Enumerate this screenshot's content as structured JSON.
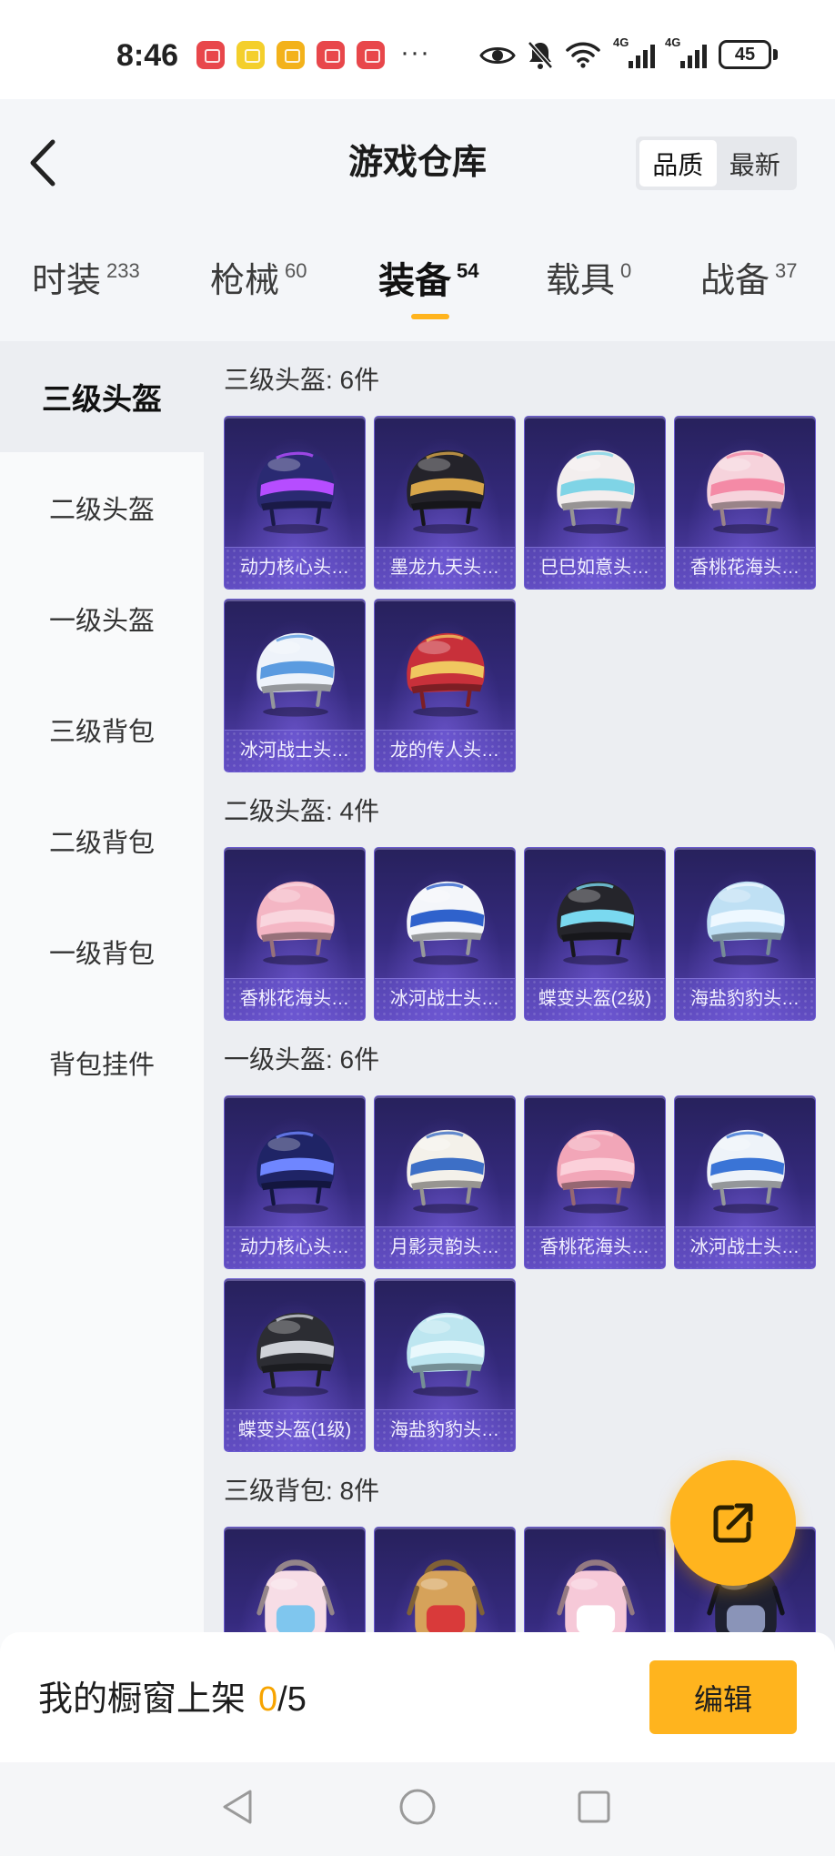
{
  "theme": {
    "accent": "#ffb41e",
    "count_highlight": "#f7a400"
  },
  "status_bar": {
    "time": "8:46",
    "notification_icons": [
      {
        "icon": "huawei-app-icon",
        "color": "#e8474b"
      },
      {
        "icon": "app-icon",
        "color": "#f4cf2c"
      },
      {
        "icon": "app-icon",
        "color": "#f3b21b"
      },
      {
        "icon": "huawei-app-icon",
        "color": "#e8474b"
      },
      {
        "icon": "huawei-app-icon",
        "color": "#e8474b"
      }
    ],
    "more": "···",
    "system_icons": [
      "eye-icon",
      "mute-bell-icon",
      "wifi-icon",
      "cellular-signal-icon",
      "cellular-signal-icon",
      "battery-icon"
    ],
    "network_label": "4G",
    "battery": "45"
  },
  "header": {
    "title": "游戏仓库",
    "back_icon": "chevron-left-icon",
    "sort_options": [
      {
        "label": "品质",
        "selected": true
      },
      {
        "label": "最新",
        "selected": false
      }
    ]
  },
  "tabs": [
    {
      "label": "时装",
      "count": "233",
      "active": false
    },
    {
      "label": "枪械",
      "count": "60",
      "active": false
    },
    {
      "label": "装备",
      "count": "54",
      "active": true
    },
    {
      "label": "载具",
      "count": "0",
      "active": false
    },
    {
      "label": "战备",
      "count": "37",
      "active": false
    }
  ],
  "sidebar": {
    "items": [
      {
        "label": "三级头盔",
        "active": true
      },
      {
        "label": "二级头盔",
        "active": false
      },
      {
        "label": "一级头盔",
        "active": false
      },
      {
        "label": "三级背包",
        "active": false
      },
      {
        "label": "二级背包",
        "active": false
      },
      {
        "label": "一级背包",
        "active": false
      },
      {
        "label": "背包挂件",
        "active": false
      }
    ]
  },
  "sections": [
    {
      "title": "三级头盔: 6件",
      "items": [
        {
          "name": "动力核心头…",
          "icon": "helmet-icon",
          "color": "#2a2a72",
          "accent": "#b64dff"
        },
        {
          "name": "墨龙九天头…",
          "icon": "helmet-icon",
          "color": "#24232a",
          "accent": "#d8a64a"
        },
        {
          "name": "巳巳如意头…",
          "icon": "helmet-icon",
          "color": "#f3eeee",
          "accent": "#7fd4e6"
        },
        {
          "name": "香桃花海头…",
          "icon": "helmet-icon",
          "color": "#f6d3dc",
          "accent": "#f48aa6"
        },
        {
          "name": "冰河战士头…",
          "icon": "helmet-icon",
          "color": "#eef3fa",
          "accent": "#5b9be0"
        },
        {
          "name": "龙的传人头…",
          "icon": "helmet-icon",
          "color": "#c8303a",
          "accent": "#f0c760"
        }
      ]
    },
    {
      "title": "二级头盔: 4件",
      "items": [
        {
          "name": "香桃花海头…",
          "icon": "helmet-icon",
          "color": "#f4b6c4",
          "accent": "#f9d6de"
        },
        {
          "name": "冰河战士头…",
          "icon": "helmet-icon",
          "color": "#f4f6fa",
          "accent": "#2f62cc"
        },
        {
          "name": "蝶变头盔(2级)",
          "icon": "helmet-icon",
          "color": "#25252b",
          "accent": "#7ad9f0"
        },
        {
          "name": "海盐豹豹头…",
          "icon": "helmet-icon",
          "color": "#bfe0f4",
          "accent": "#eef8ff"
        }
      ]
    },
    {
      "title": "一级头盔: 6件",
      "items": [
        {
          "name": "动力核心头…",
          "icon": "helmet-icon",
          "color": "#1f2466",
          "accent": "#6f86ff"
        },
        {
          "name": "月影灵韵头…",
          "icon": "helmet-icon",
          "color": "#f4f1ea",
          "accent": "#3d6fc6"
        },
        {
          "name": "香桃花海头…",
          "icon": "helmet-icon",
          "color": "#f2a6b8",
          "accent": "#fbd0da"
        },
        {
          "name": "冰河战士头…",
          "icon": "helmet-icon",
          "color": "#eef3f9",
          "accent": "#3a74d6"
        },
        {
          "name": "蝶变头盔(1级)",
          "icon": "helmet-icon",
          "color": "#2c2d33",
          "accent": "#cfd2d8"
        },
        {
          "name": "海盐豹豹头…",
          "icon": "helmet-icon",
          "color": "#bde6f0",
          "accent": "#e9f8fc"
        }
      ]
    },
    {
      "title": "三级背包: 8件",
      "items": [
        {
          "icon": "backpack-icon",
          "color": "#f7dde6",
          "accent": "#7fc6ee"
        },
        {
          "icon": "backpack-icon",
          "color": "#d6a25a",
          "accent": "#d93a3a"
        },
        {
          "icon": "backpack-icon",
          "color": "#f6c9d8",
          "accent": "#ffffff"
        },
        {
          "icon": "backpack-icon",
          "color": "#1e2030",
          "accent": "#8a94b8"
        }
      ]
    }
  ],
  "fab": {
    "icon": "share-external-icon"
  },
  "bottom_bar": {
    "label": "我的橱窗上架",
    "shelved": "0",
    "limit": "/5",
    "edit_button": "编辑"
  },
  "nav_bar": {
    "icons": [
      "back-triangle-icon",
      "home-circle-icon",
      "recents-square-icon"
    ]
  }
}
